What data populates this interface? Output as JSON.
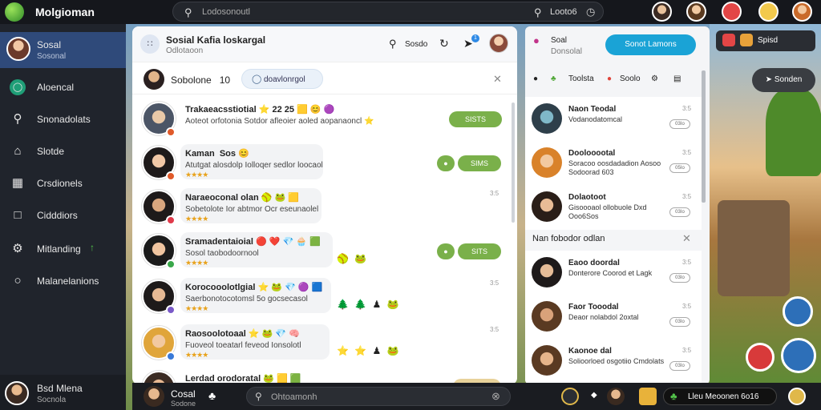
{
  "topbar": {
    "app_title": "Molgioman",
    "search_placeholder": "Lodosonoutl",
    "search_right_text": "Looto6"
  },
  "sidebar": {
    "user": {
      "name": "Sosal",
      "sub": "Sosonal"
    },
    "items": [
      {
        "label": "Aloencal",
        "icon": "globe-icon"
      },
      {
        "label": "Snonadolats",
        "icon": "search-icon"
      },
      {
        "label": "Slotde",
        "icon": "home-icon"
      },
      {
        "label": "Crsdionels",
        "icon": "chart-icon"
      },
      {
        "label": "Cidddiors",
        "icon": "calendar-icon"
      },
      {
        "label": "Mitlanding",
        "icon": "gear-icon"
      },
      {
        "label": "Malanelanions",
        "icon": "chat-icon"
      }
    ],
    "footer": {
      "name": "Bsd Mlena",
      "sub": "Socnola"
    }
  },
  "main": {
    "header": {
      "title": "Sosial Kafia loskargal",
      "subtitle": "Odlotaoon",
      "search_label": "Sosdo"
    },
    "subbar": {
      "label": "Sobolone",
      "count": "10",
      "pill": "doavlonrgol"
    },
    "rows": [
      {
        "name": "Trakaeacsstiotial",
        "extras": "⭐ 22 25 🟨 😊 🟣",
        "desc": "Aoteot orfotonia Sotdor afleoier aoled aopanaoncl ⭐",
        "stars": "",
        "time": "",
        "emoji": "",
        "button": "SISTS",
        "mini": ""
      },
      {
        "name": "Kaman",
        "extras": "Sos 😊",
        "desc": "Atutgat alosdolp Iolloqer sedlor loocaol",
        "stars": "★★★★",
        "time": "",
        "emoji": "",
        "button": "SIMS",
        "mini": "●"
      },
      {
        "name": "Naraeoconal olan",
        "extras": "🥎 🐸 🟨",
        "desc": "Sobetolote Ior abtmor Ocr eseunaolel",
        "stars": "★★★★",
        "time": "3:5",
        "emoji": "",
        "button": "",
        "mini": ""
      },
      {
        "name": "Sramadentaioial",
        "extras": "🔴 ❤️ 💎 🧁 🟩",
        "desc": "Sosol taobodoornool",
        "stars": "★★★★",
        "time": "",
        "emoji": "🥎 🐸",
        "button": "SITS",
        "mini": "●"
      },
      {
        "name": "Korocooolotlgial",
        "extras": "⭐ 🐸 💎 🟣 🟦",
        "desc": "Saerbonotocotomsl 5o gocsecasol",
        "stars": "★★★★",
        "time": "3:5",
        "emoji": "🌲 🌲 ♟ 🐸",
        "button": "",
        "mini": ""
      },
      {
        "name": "Raosoolotoaal",
        "extras": "⭐ 🐸 💎 🧠",
        "desc": "Fuoveol toeatarl feveod Ionsolotl",
        "stars": "★★★★",
        "time": "3:5",
        "emoji": "⭐ ⭐ ♟ 🐸",
        "button": "",
        "mini": ""
      },
      {
        "name": "Lerdad orodoratal",
        "extras": "🐸 🟨 🟩",
        "desc": "",
        "stars": "",
        "time": "",
        "emoji": "",
        "button": "",
        "mini": ""
      }
    ]
  },
  "right_panel": {
    "header": {
      "title": "Soal",
      "sub": "Donsolal"
    },
    "pill": "Sonot Lamons",
    "tabs": [
      "Toolsta",
      "Soolo"
    ],
    "cards": [
      {
        "name": "Naon Teodal",
        "desc": "Vodanodatomcal",
        "time": "3:5",
        "tog": "03Io"
      },
      {
        "name": "Doolooootal",
        "desc": "Soracoo oosdadadion Aosoo Sodoorad 603",
        "time": "3:5",
        "tog": "05Io"
      },
      {
        "name": "Dolaotoot",
        "desc": "Gisoooaol ollobuole Dxd Ooo6Sos",
        "time": "3:5",
        "tog": "03Io"
      }
    ],
    "section_title": "Nan fobodor odlan",
    "cards2": [
      {
        "name": "Eaoo doordal",
        "desc": "Donterore Coorod et Lagk",
        "time": "3:5",
        "tog": "03Io"
      },
      {
        "name": "Faor Tooodal",
        "desc": "Deaor nolabdol 2oxtal",
        "time": "3:5",
        "tog": "03Io"
      },
      {
        "name": "Kaonoe dal",
        "desc": "Solioorloed osgotiio Cmdolats",
        "time": "3:5",
        "tog": "03Io"
      }
    ]
  },
  "game_overlay": {
    "chip_text": "Spisd",
    "button": "Sonden"
  },
  "bottombar": {
    "user": {
      "name": "Cosal",
      "sub": "Sodone"
    },
    "search_placeholder": "Ohtoamonh",
    "status": "Lleu Meoonen 6o16"
  },
  "colors": {
    "accent": "#1aa3d6",
    "green": "#7ab04a",
    "sidebar_bg": "#20242c",
    "sidebar_active": "#2f4a7a"
  }
}
